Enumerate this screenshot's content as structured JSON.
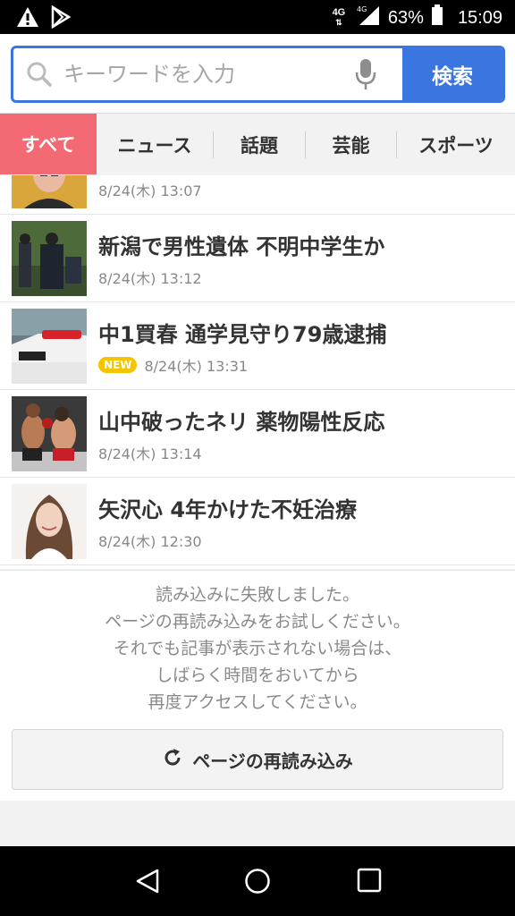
{
  "statusbar": {
    "network_top": "4G",
    "network_small": "4G",
    "battery": "63%",
    "time": "15:09"
  },
  "search": {
    "placeholder": "キーワードを入力",
    "button_label": "検索"
  },
  "tabs": [
    {
      "label": "すべて"
    },
    {
      "label": "ニュース"
    },
    {
      "label": "話題"
    },
    {
      "label": "芸能"
    },
    {
      "label": "スポーツ"
    }
  ],
  "news": [
    {
      "title": "",
      "date": "8/24(木) 13:07",
      "badge": ""
    },
    {
      "title": "新潟で男性遺体 不明中学生か",
      "date": "8/24(木) 13:12",
      "badge": ""
    },
    {
      "title": "中1買春 通学見守り79歳逮捕",
      "date": "8/24(木) 13:31",
      "badge": "NEW"
    },
    {
      "title": "山中破ったネリ 薬物陽性反応",
      "date": "8/24(木) 13:14",
      "badge": ""
    },
    {
      "title": "矢沢心 4年かけた不妊治療",
      "date": "8/24(木) 12:30",
      "badge": ""
    }
  ],
  "error": {
    "lines": [
      "読み込みに失敗しました。",
      "ページの再読み込みをお試しください。",
      "それでも記事が表示されない場合は、",
      "しばらく時間をおいてから",
      "再度アクセスしてください。"
    ],
    "reload_label": "ページの再読み込み"
  },
  "colors": {
    "accent_blue": "#3b76e0",
    "active_tab": "#f36a74",
    "new_badge": "#f5c400"
  }
}
